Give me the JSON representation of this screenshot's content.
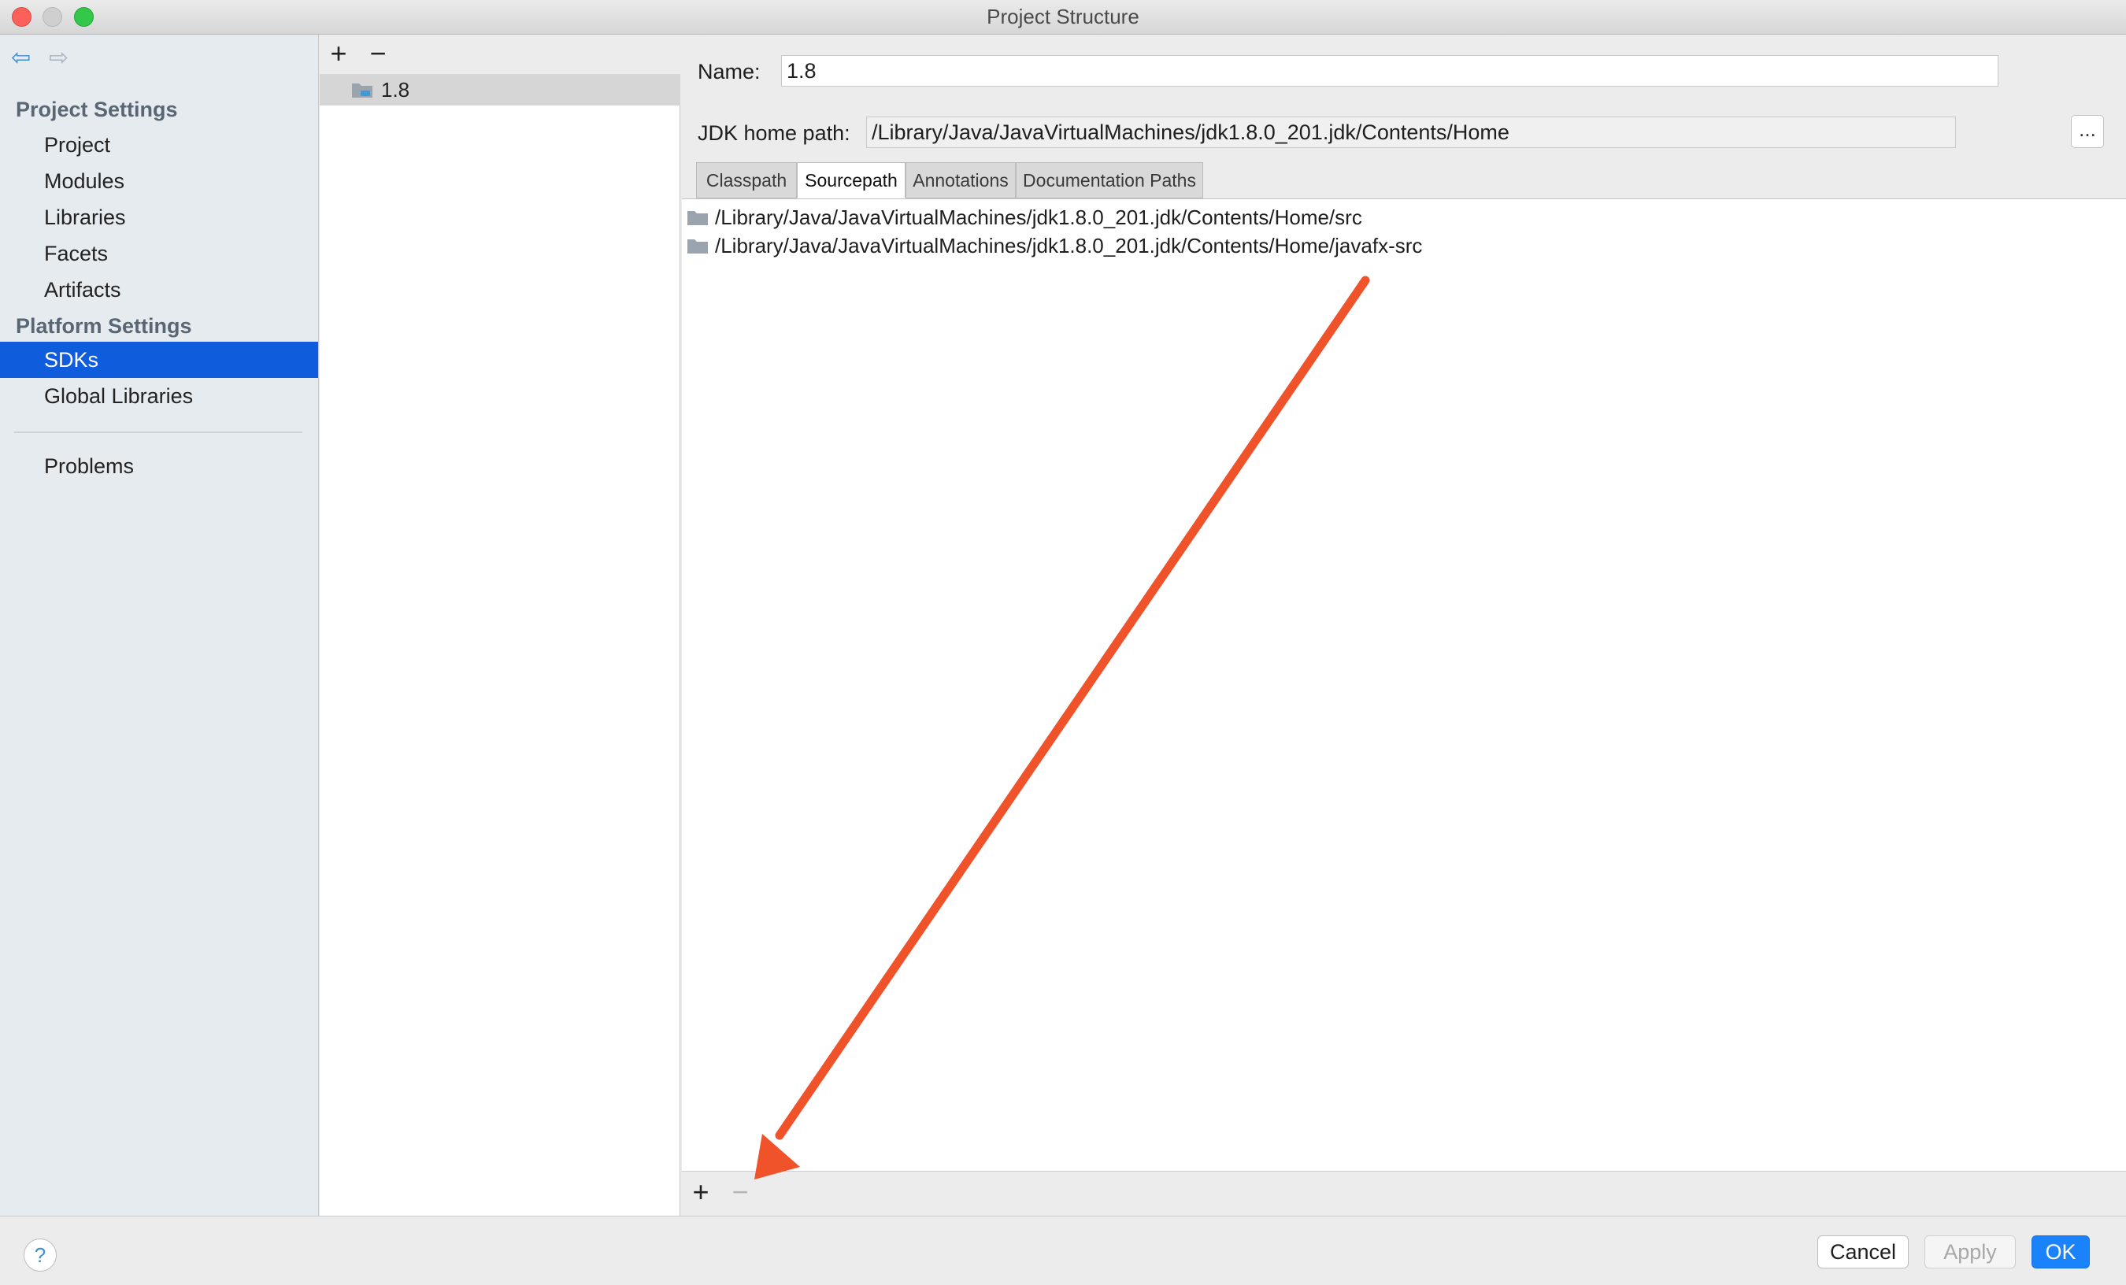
{
  "window": {
    "title": "Project Structure"
  },
  "sidebar": {
    "sections": [
      {
        "header": "Project Settings",
        "items": [
          "Project",
          "Modules",
          "Libraries",
          "Facets",
          "Artifacts"
        ]
      },
      {
        "header": "Platform Settings",
        "items": [
          "SDKs",
          "Global Libraries"
        ]
      }
    ],
    "extra_items": [
      "Problems"
    ],
    "selected": "SDKs"
  },
  "sdk_list": {
    "add_label": "+",
    "remove_label": "−",
    "items": [
      "1.8"
    ]
  },
  "sdk_detail": {
    "name_label": "Name:",
    "name_value": "1.8",
    "jdk_label": "JDK home path:",
    "jdk_value": "/Library/Java/JavaVirtualMachines/jdk1.8.0_201.jdk/Contents/Home",
    "browse_label": "...",
    "tabs": [
      "Classpath",
      "Sourcepath",
      "Annotations",
      "Documentation Paths"
    ],
    "active_tab": "Sourcepath",
    "paths": [
      "/Library/Java/JavaVirtualMachines/jdk1.8.0_201.jdk/Contents/Home/src",
      "/Library/Java/JavaVirtualMachines/jdk1.8.0_201.jdk/Contents/Home/javafx-src"
    ],
    "list_add_label": "+",
    "list_remove_label": "−"
  },
  "buttons": {
    "help": "?",
    "cancel": "Cancel",
    "apply": "Apply",
    "ok": "OK"
  },
  "colors": {
    "selection": "#0f5ddc",
    "ok_button": "#1a82fb",
    "annotation_arrow": "#f0522a"
  }
}
